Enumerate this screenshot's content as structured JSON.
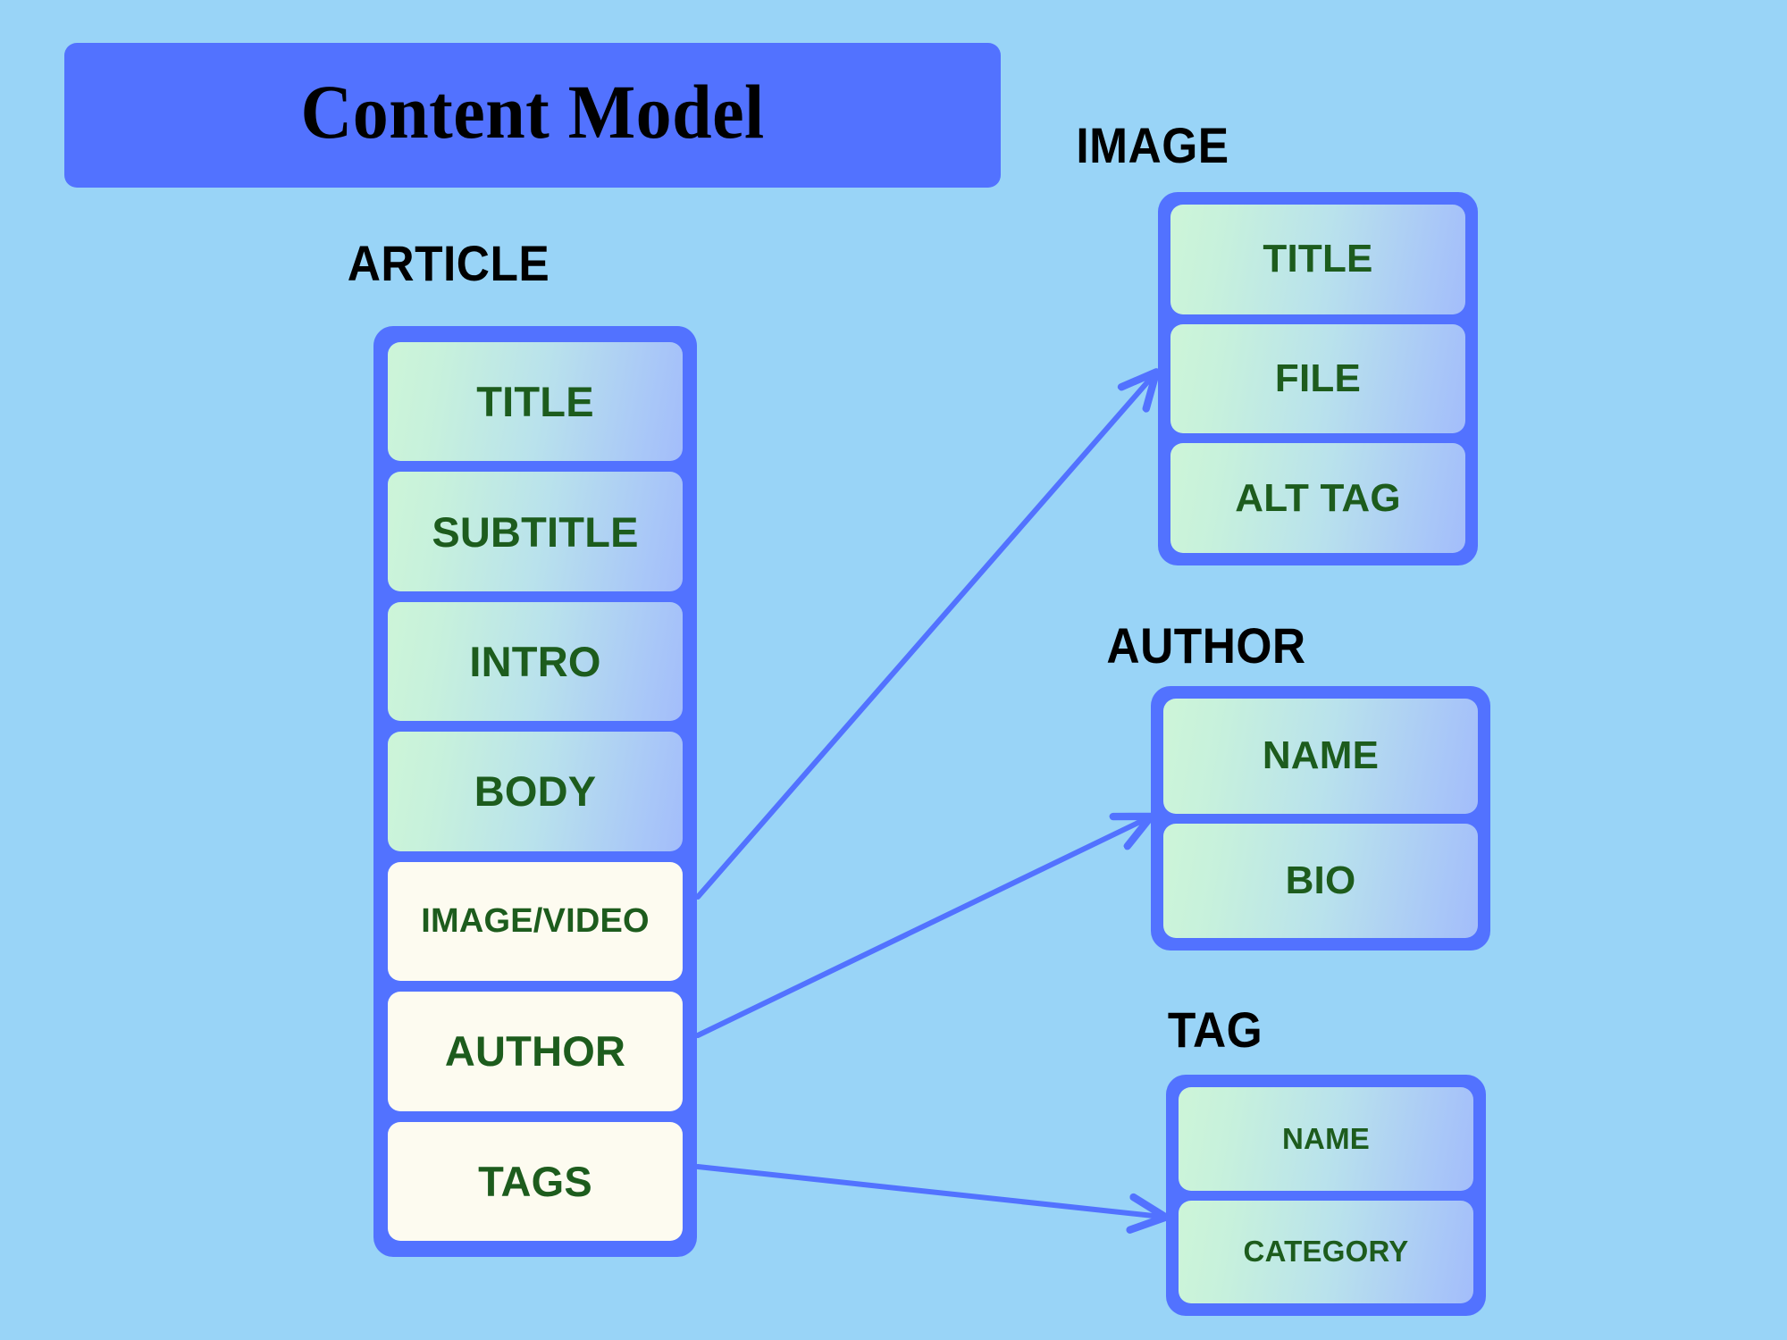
{
  "diagram": {
    "title": "Content Model",
    "background_color": "#99d4f7",
    "accent_color": "#5272ff",
    "field_text_color": "#1d5c1d",
    "cream_color": "#fdfbf0"
  },
  "entities": {
    "article": {
      "label": "ARTICLE",
      "fields": [
        {
          "label": "TITLE",
          "style": "gradient"
        },
        {
          "label": "SUBTITLE",
          "style": "gradient"
        },
        {
          "label": "INTRO",
          "style": "gradient"
        },
        {
          "label": "BODY",
          "style": "gradient"
        },
        {
          "label": "IMAGE/VIDEO",
          "style": "cream"
        },
        {
          "label": "AUTHOR",
          "style": "cream"
        },
        {
          "label": "TAGS",
          "style": "cream"
        }
      ]
    },
    "image": {
      "label": "IMAGE",
      "fields": [
        {
          "label": "TITLE",
          "style": "gradient"
        },
        {
          "label": "FILE",
          "style": "gradient"
        },
        {
          "label": "ALT TAG",
          "style": "gradient"
        }
      ]
    },
    "author": {
      "label": "AUTHOR",
      "fields": [
        {
          "label": "NAME",
          "style": "gradient"
        },
        {
          "label": "BIO",
          "style": "gradient"
        }
      ]
    },
    "tag": {
      "label": "TAG",
      "fields": [
        {
          "label": "NAME",
          "style": "gradient"
        },
        {
          "label": "CATEGORY",
          "style": "gradient"
        }
      ]
    }
  },
  "relations": [
    {
      "from": "article.IMAGE/VIDEO",
      "to": "image.FILE"
    },
    {
      "from": "article.AUTHOR",
      "to": "author.NAME"
    },
    {
      "from": "article.TAGS",
      "to": "tag.CATEGORY"
    }
  ]
}
